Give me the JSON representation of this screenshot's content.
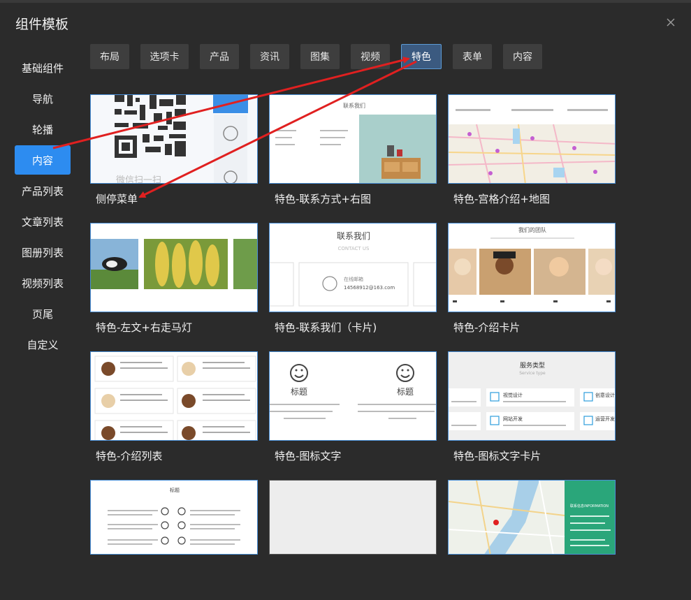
{
  "dialog": {
    "title": "组件模板"
  },
  "sidebar": {
    "items": [
      {
        "label": "基础组件"
      },
      {
        "label": "导航"
      },
      {
        "label": "轮播"
      },
      {
        "label": "内容",
        "active": true
      },
      {
        "label": "产品列表"
      },
      {
        "label": "文章列表"
      },
      {
        "label": "图册列表"
      },
      {
        "label": "视频列表"
      },
      {
        "label": "页尾"
      },
      {
        "label": "自定义"
      }
    ]
  },
  "tabs": [
    {
      "label": "布局"
    },
    {
      "label": "选项卡"
    },
    {
      "label": "产品"
    },
    {
      "label": "资讯"
    },
    {
      "label": "图集"
    },
    {
      "label": "视频"
    },
    {
      "label": "特色",
      "active": true
    },
    {
      "label": "表单"
    },
    {
      "label": "内容"
    }
  ],
  "cards": [
    {
      "label": "侧停菜单"
    },
    {
      "label": "特色-联系方式+右图"
    },
    {
      "label": "特色-宫格介绍+地图"
    },
    {
      "label": "特色-左文+右走马灯"
    },
    {
      "label": "特色-联系我们（卡片)"
    },
    {
      "label": "特色-介绍卡片"
    },
    {
      "label": "特色-介绍列表"
    },
    {
      "label": "特色-图标文字"
    },
    {
      "label": "特色-图标文字卡片"
    },
    {
      "label": ""
    },
    {
      "label": ""
    },
    {
      "label": ""
    }
  ],
  "previews": {
    "qr_caption": "微信扫一扫",
    "contact_title": "联系我们",
    "contact_subtitle": "CONTACT US",
    "contact_email_label": "在线邮箱",
    "contact_email": "14568912@163.com",
    "team_title": "我们的团队",
    "icon_title": "标题",
    "service_title": "服务类型",
    "service_subtitle": "Service type",
    "service_items": [
      "视觉设计",
      "网站开发",
      "创意设计",
      "运营开发"
    ],
    "info_title": "联系信息INFORMATION",
    "list_title": "标题"
  },
  "colors": {
    "accent": "#2d8cf0",
    "background": "#2b2b2b",
    "tab_bg": "#3e3e3e",
    "arrow": "#e02020",
    "info_green": "#2aa67a"
  }
}
